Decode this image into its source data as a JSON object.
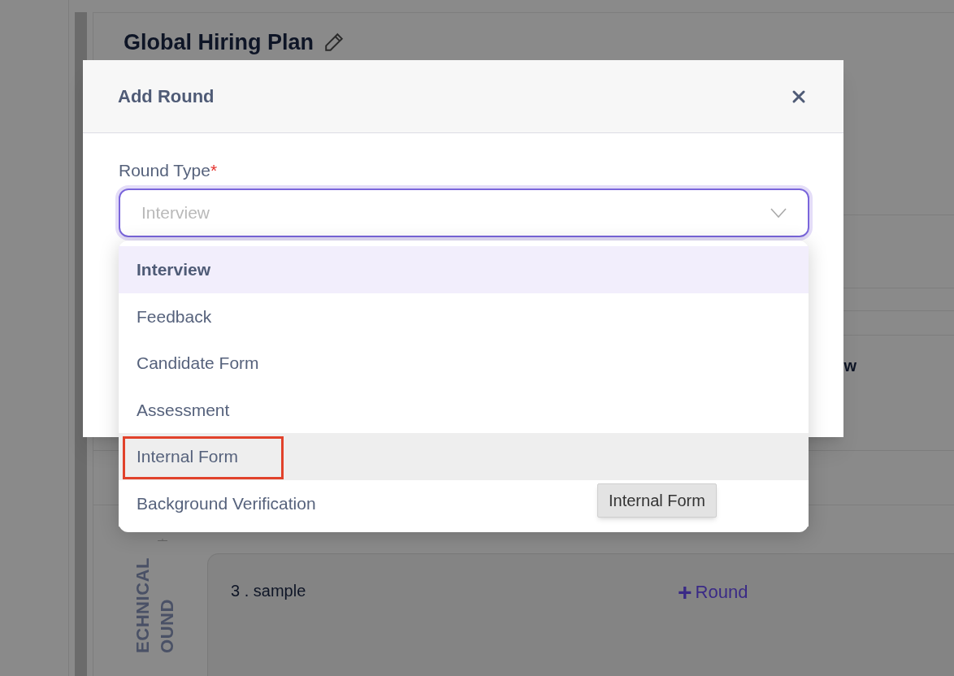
{
  "page": {
    "title": "Global Hiring Plan",
    "partial_text": "w",
    "stage_label": [
      "ECHNICAL",
      "OUND"
    ],
    "card": {
      "title": "3 . sample",
      "action_icon": "+",
      "action": "Round"
    }
  },
  "dialog": {
    "title": "Add Round",
    "field": {
      "label": "Round Type",
      "required_mark": "*",
      "placeholder": "Interview"
    },
    "options": [
      {
        "label": "Interview",
        "selected": true,
        "hovered": false,
        "highlighted": false
      },
      {
        "label": "Feedback",
        "selected": false,
        "hovered": false,
        "highlighted": false
      },
      {
        "label": "Candidate Form",
        "selected": false,
        "hovered": false,
        "highlighted": false
      },
      {
        "label": "Assessment",
        "selected": false,
        "hovered": false,
        "highlighted": false
      },
      {
        "label": "Internal Form",
        "selected": false,
        "hovered": true,
        "highlighted": true
      },
      {
        "label": "Background Verification",
        "selected": false,
        "hovered": false,
        "highlighted": false
      }
    ],
    "tooltip": "Internal Form"
  }
}
